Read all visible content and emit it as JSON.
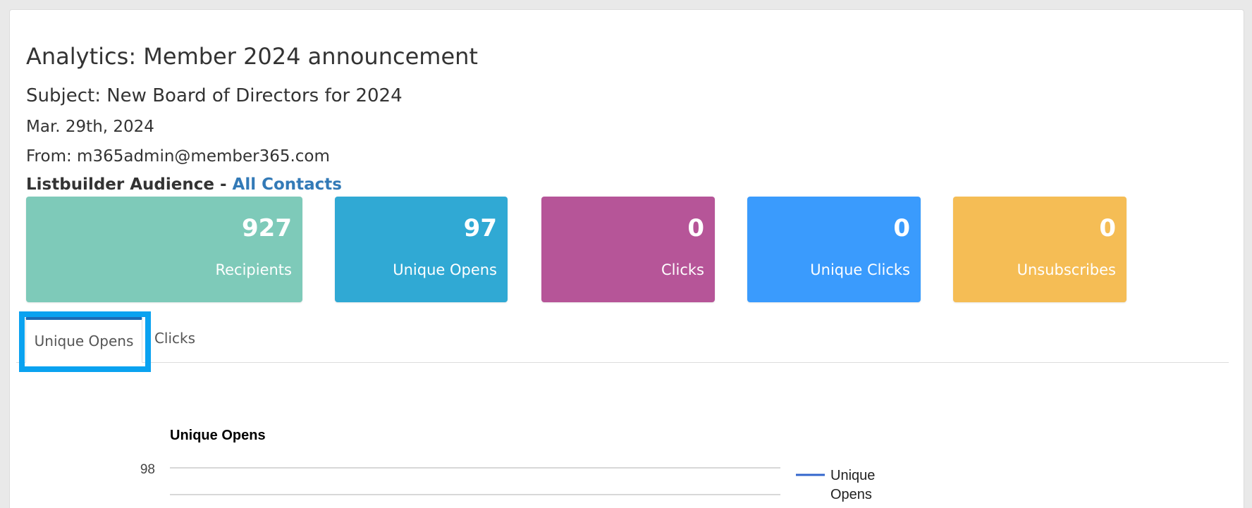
{
  "header": {
    "title": "Analytics: Member 2024 announcement",
    "subject": "Subject: New Board of Directors for 2024",
    "date": "Mar. 29th, 2024",
    "from": "From: m365admin@member365.com",
    "audience_prefix": "Listbuilder Audience - ",
    "audience_link": "All Contacts"
  },
  "stats": [
    {
      "value": "927",
      "label": "Recipients",
      "color": "#7ecab9"
    },
    {
      "value": "97",
      "label": "Unique Opens",
      "color": "#30a9d4"
    },
    {
      "value": "0",
      "label": "Clicks",
      "color": "#b65598"
    },
    {
      "value": "0",
      "label": "Unique Clicks",
      "color": "#3a9bfd"
    },
    {
      "value": "0",
      "label": "Unsubscribes",
      "color": "#f5bd55"
    }
  ],
  "tabs": [
    {
      "label": "Unique Opens",
      "active": true
    },
    {
      "label": "Clicks",
      "active": false
    }
  ],
  "chart_data": {
    "type": "line",
    "title": "Unique Opens",
    "series": [
      {
        "name": "Unique Opens",
        "color": "#3366cc",
        "values": []
      }
    ],
    "y_ticks": [
      98
    ],
    "legend_position": "right"
  }
}
